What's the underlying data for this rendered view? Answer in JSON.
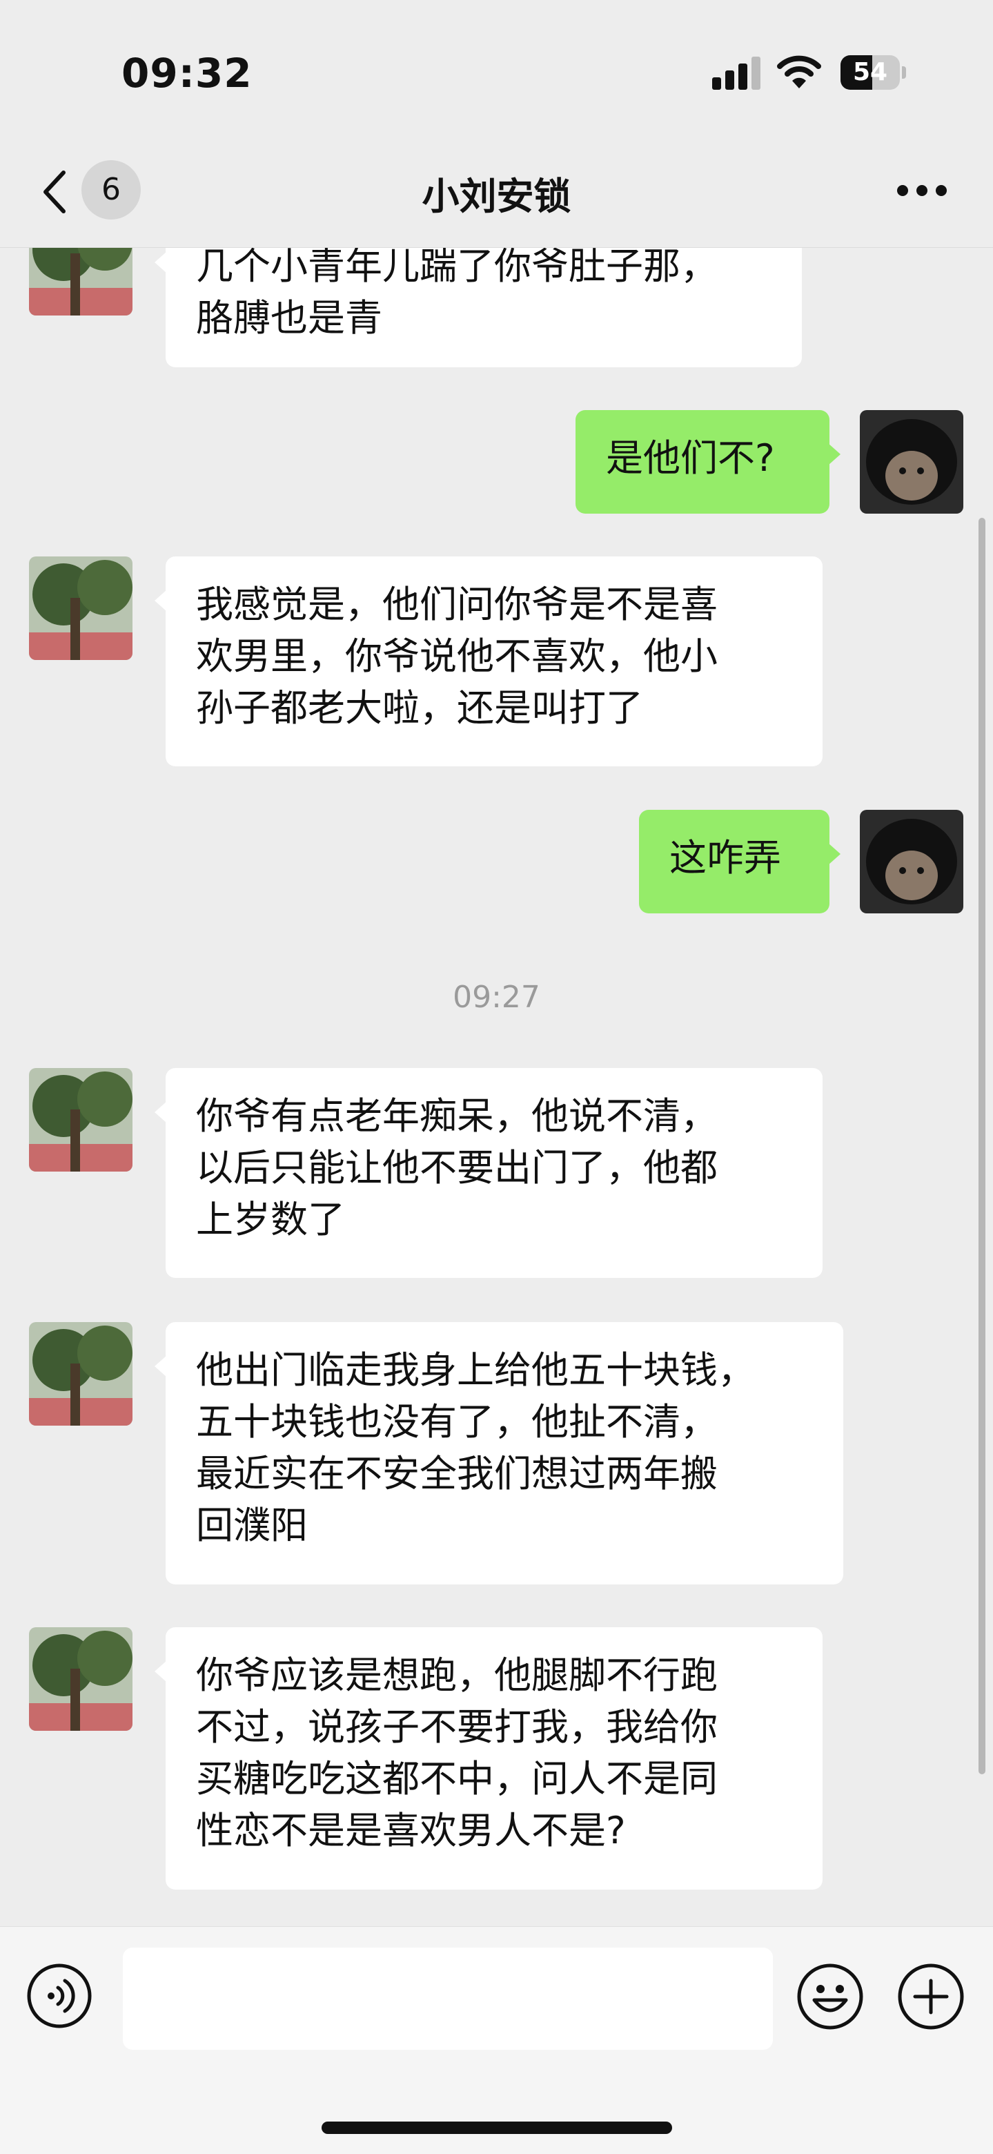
{
  "status_bar": {
    "time": "09:32",
    "battery": "54",
    "battery_level": 0.54
  },
  "nav": {
    "unread_count": "6",
    "title": "小刘安锁"
  },
  "messages": [
    {
      "side": "in",
      "text": "几个小青年儿踹了你爷肚子那，\n胳膊也是青"
    },
    {
      "side": "out",
      "text": "是他们不?"
    },
    {
      "side": "in",
      "text": "我感觉是，他们问你爷是不是喜\n欢男里，你爷说他不喜欢，他小\n孙子都老大啦，还是叫打了"
    },
    {
      "side": "out",
      "text": "这咋弄"
    },
    {
      "side": "time",
      "text": "09:27"
    },
    {
      "side": "in",
      "text": "你爷有点老年痴呆，他说不清，\n以后只能让他不要出门了，他都\n上岁数了"
    },
    {
      "side": "in",
      "text": "他出门临走我身上给他五十块钱，\n五十块钱也没有了，他扯不清，\n最近实在不安全我们想过两年搬\n回濮阳"
    },
    {
      "side": "in",
      "text": "你爷应该是想跑，他腿脚不行跑\n不过，说孩子不要打我，我给你\n买糖吃吃这都不中，问人不是同\n性恋不是是喜欢男人不是?"
    }
  ],
  "input_bar": {
    "text": ""
  },
  "colors": {
    "incoming_bubble": "#ffffff",
    "outgoing_bubble": "#95ec69",
    "background": "#ededed"
  }
}
